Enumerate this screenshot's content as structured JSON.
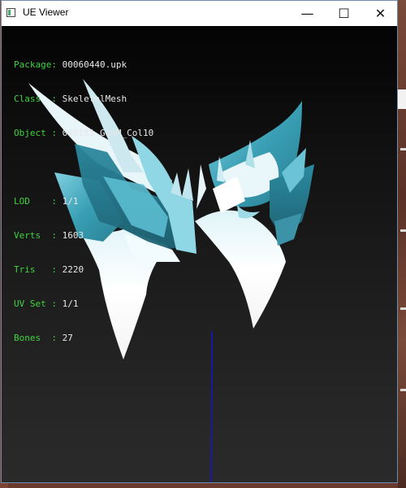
{
  "window": {
    "title": "UE Viewer",
    "minimize_glyph": "—",
    "maximize_glyph": "☐",
    "close_glyph": "✕"
  },
  "info": {
    "package_label": "Package: ",
    "package_value": "00060440.upk",
    "class_label": "Class  : ",
    "class_value": "SkeletalMesh",
    "object_label": "Object : ",
    "object_value": "090181_GonM_Col10",
    "lod_label": "LOD    : ",
    "lod_value": "1/1",
    "verts_label": "Verts  : ",
    "verts_value": "1603",
    "tris_label": "Tris   : ",
    "tris_value": "2220",
    "uvset_label": "UV Set : ",
    "uvset_value": "1/1",
    "bones_label": "Bones  : ",
    "bones_value": "27"
  },
  "colors": {
    "label_green": "#3fd43f",
    "value_white": "#e8e8e8",
    "mesh_cyan": "#3aa7bd",
    "axis_blue": "#1515c8"
  }
}
